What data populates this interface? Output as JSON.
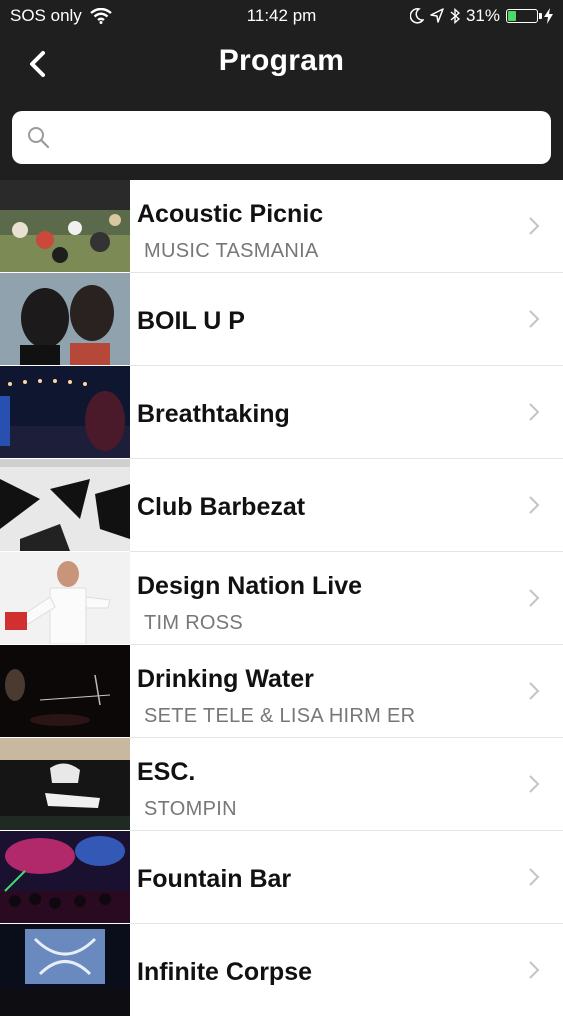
{
  "status_bar": {
    "carrier": "SOS only",
    "time": "11:42 pm",
    "battery_percent": "31%",
    "battery_level": 0.31,
    "icons": [
      "wifi-icon",
      "moon-icon",
      "location-arrow-icon",
      "bluetooth-icon",
      "battery-icon",
      "charging-bolt-icon"
    ]
  },
  "nav": {
    "title": "Program",
    "back_icon": "chevron-left-icon"
  },
  "search": {
    "value": "",
    "placeholder": "",
    "icon": "search-icon"
  },
  "program_items": [
    {
      "title": "Acoustic Picnic",
      "subtitle": "MUSIC TASMANIA"
    },
    {
      "title": "BOIL U P",
      "subtitle": ""
    },
    {
      "title": "Breathtaking",
      "subtitle": ""
    },
    {
      "title": "Club Barbezat",
      "subtitle": ""
    },
    {
      "title": "Design Nation Live",
      "subtitle": "TIM ROSS"
    },
    {
      "title": "Drinking Water",
      "subtitle": "SETE TELE & LISA HIRM ER"
    },
    {
      "title": "ESC.",
      "subtitle": "STOMPIN"
    },
    {
      "title": "Fountain Bar",
      "subtitle": ""
    },
    {
      "title": "Infinite Corpse",
      "subtitle": ""
    }
  ],
  "colors": {
    "header_bg": "#1f1f1f",
    "battery_green": "#4cd964",
    "title_text": "#111111",
    "subtitle_text": "#777777"
  }
}
